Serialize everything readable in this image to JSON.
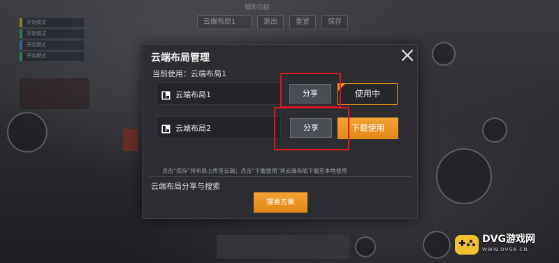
{
  "background": {
    "top_title": "辅助功能",
    "top_bar": [
      "云端布局1",
      "退出",
      "重置",
      "保存"
    ],
    "side_list": [
      "开始模式",
      "开始模式",
      "开始模式",
      "开始模式"
    ]
  },
  "modal": {
    "title": "云端布局管理",
    "current_usage": "当前使用：云端布局1",
    "layouts": [
      {
        "name": "云端布局1",
        "share_label": "分享",
        "action_label": "使用中",
        "in_use": true
      },
      {
        "name": "云端布局2",
        "share_label": "分享",
        "action_label": "下载使用",
        "in_use": false
      }
    ],
    "hint": "点击“保存”将布局上传至云端；点击“下载使用”将云端布局下载至本地使用",
    "share_search_label": "云端布局分享与搜索",
    "search_button": "搜索方案",
    "close_icon": "close-icon"
  },
  "watermark": {
    "brand": "DVG游戏网",
    "domain": "WWW.DVG6.CN"
  },
  "colors": {
    "accent_orange": "#e8931e",
    "highlight_red": "#e0141e",
    "modal_bg": "#2b2d31"
  }
}
